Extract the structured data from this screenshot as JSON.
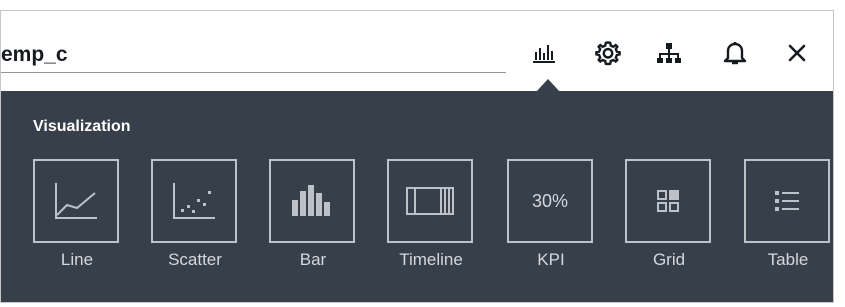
{
  "header": {
    "visualization_name": "emp_c",
    "icons": [
      "visualization-chart-icon",
      "settings-gear-icon",
      "hierarchy-icon",
      "notification-bell-icon",
      "close-icon"
    ]
  },
  "panel": {
    "title": "Visualization",
    "types": [
      {
        "label": "Line",
        "icon": "line-chart-icon"
      },
      {
        "label": "Scatter",
        "icon": "scatter-chart-icon"
      },
      {
        "label": "Bar",
        "icon": "bar-chart-icon"
      },
      {
        "label": "Timeline",
        "icon": "timeline-icon"
      },
      {
        "label": "KPI",
        "icon": "kpi-icon",
        "icon_text": "30%"
      },
      {
        "label": "Grid",
        "icon": "grid-icon"
      },
      {
        "label": "Table",
        "icon": "table-list-icon"
      }
    ]
  },
  "colors": {
    "panel_background": "#373f4b",
    "tile_border": "#bcc2c8",
    "header_icon": "#16191f"
  }
}
